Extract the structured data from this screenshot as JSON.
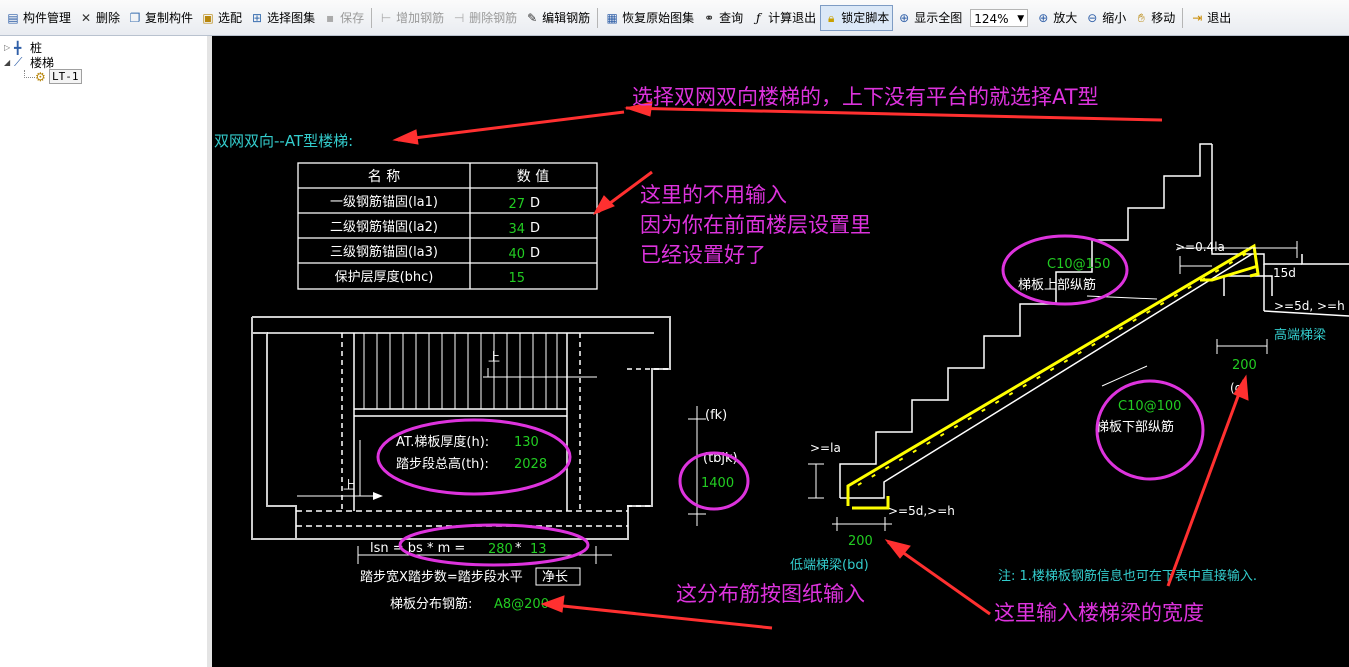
{
  "toolbar": {
    "items": [
      {
        "label": "构件管理",
        "icon": "component-manage-icon",
        "enabled": true
      },
      {
        "label": "删除",
        "icon": "delete-icon",
        "enabled": true
      },
      {
        "label": "复制构件",
        "icon": "copy-icon",
        "enabled": true
      },
      {
        "label": "选配",
        "icon": "select-config-icon",
        "enabled": true
      },
      {
        "label": "选择图集",
        "icon": "select-atlas-icon",
        "enabled": true
      },
      {
        "label": "保存",
        "icon": "save-icon",
        "enabled": false
      },
      {
        "label": "增加钢筋",
        "icon": "add-rebar-icon",
        "enabled": false
      },
      {
        "label": "删除钢筋",
        "icon": "delete-rebar-icon",
        "enabled": false
      },
      {
        "label": "编辑钢筋",
        "icon": "edit-rebar-icon",
        "enabled": true
      },
      {
        "label": "恢复原始图集",
        "icon": "restore-atlas-icon",
        "enabled": true
      },
      {
        "label": "查询",
        "icon": "binoculars-icon",
        "enabled": true
      },
      {
        "label": "计算退出",
        "icon": "formula-icon",
        "enabled": true
      },
      {
        "label": "锁定脚本",
        "icon": "lock-icon",
        "enabled": true
      },
      {
        "label": "显示全图",
        "icon": "zoom-fit-icon",
        "enabled": true
      },
      {
        "label": "放大",
        "icon": "zoom-in-icon",
        "enabled": true
      },
      {
        "label": "缩小",
        "icon": "zoom-out-icon",
        "enabled": true
      },
      {
        "label": "移动",
        "icon": "pan-hand-icon",
        "enabled": true
      },
      {
        "label": "退出",
        "icon": "exit-icon",
        "enabled": true
      }
    ],
    "zoom": "124%"
  },
  "tree": {
    "nodes": [
      {
        "label": "桩",
        "icon": "pile-icon"
      },
      {
        "label": "楼梯",
        "icon": "stair-icon"
      },
      {
        "label": "LT-1",
        "icon": "gear-icon"
      }
    ]
  },
  "canvas": {
    "title": "双网双向--AT型楼梯:",
    "table": {
      "headers": [
        "名 称",
        "数 值"
      ],
      "rows": [
        {
          "name": "一级钢筋锚固(la1)",
          "value": "27",
          "unit": "D"
        },
        {
          "name": "二级钢筋锚固(la2)",
          "value": "34",
          "unit": "D"
        },
        {
          "name": "三级钢筋锚固(la3)",
          "value": "40",
          "unit": "D"
        },
        {
          "name": "保护层厚度(bhc)",
          "value": "15",
          "unit": ""
        }
      ]
    },
    "plan": {
      "up_top": "上",
      "up_bottom": "上",
      "thickness_label": "AT.梯板厚度(h):",
      "thickness_value": "130",
      "height_label": "踏步段总高(th):",
      "height_value": "2028",
      "lsn_label": "lsn = bs * m =",
      "bs_value": "280",
      "times": "*",
      "m_value": "13",
      "lsn_desc_pre": "踏步宽X踏步数=踏步段水平",
      "lsn_desc_box": "净长",
      "dist_label": "梯板分布钢筋:",
      "dist_value": "A8@200"
    },
    "dims": {
      "fk": "(fk)",
      "tbjk": "(tbjk)",
      "width_value": "1400"
    },
    "section": {
      "top_rebar_value": "C10@150",
      "top_rebar_label": "梯板上部纵筋",
      "bottom_rebar_value": "C10@100",
      "bottom_rebar_label": "梯板下部纵筋",
      "anchor_top": ">=0.4la",
      "hook_15d": "15d",
      "anchor_high": ">=5d, >=h",
      "high_beam": "高端梯梁",
      "high_width": "200",
      "high_width_label": "(g)",
      "la_low": ">=la",
      "anchor_low": ">=5d,>=h",
      "low_width": "200",
      "low_beam": "低端梯梁(bd)"
    },
    "note": "注: 1.楼梯板钢筋信息也可在下表中直接输入.",
    "annotations": {
      "a1": "选择双网双向楼梯的，上下没有平台的就选择AT型",
      "a2_line1": "这里的不用输入",
      "a2_line2": "因为你在前面楼层设置里",
      "a2_line3": "已经设置好了",
      "a3": "这分布筋按图纸输入",
      "a4": "这里输入楼梯梁的宽度"
    },
    "colors": {
      "annotation": "#dd33dd",
      "arrow": "#ff3030",
      "value": "#22cc22",
      "cyan": "#33cccc",
      "rebar": "#ffff00",
      "line": "#ffffff"
    }
  }
}
